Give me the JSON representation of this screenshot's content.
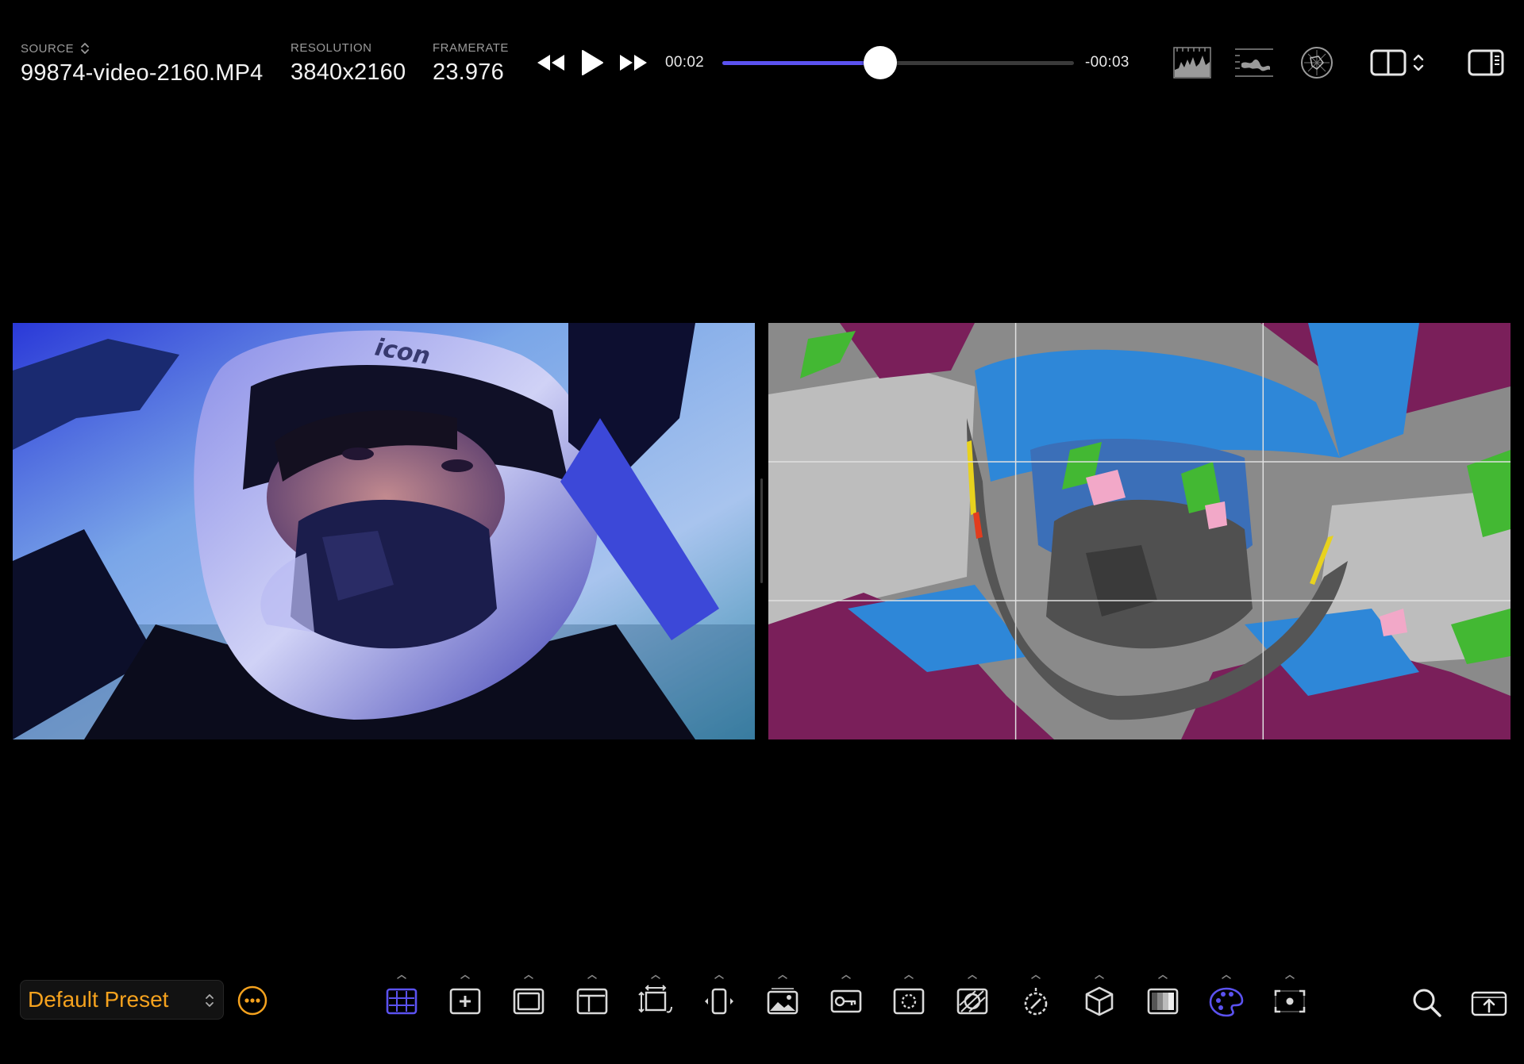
{
  "source": {
    "label": "SOURCE",
    "filename": "99874-video-2160.MP4"
  },
  "resolution": {
    "label": "RESOLUTION",
    "value": "3840x2160"
  },
  "framerate": {
    "label": "FRAMERATE",
    "value": "23.976"
  },
  "playback": {
    "current_time": "00:02",
    "remaining_time": "-00:03",
    "progress": 0.45
  },
  "colors": {
    "accent": "#5b52f0",
    "preset": "#f5a21e",
    "icon": "#d9d9d9"
  },
  "top_icons": [
    "histogram-icon",
    "waveform-icon",
    "vectorscope-icon",
    "split-view-icon",
    "sidebar-icon"
  ],
  "viewers": {
    "left": "original",
    "right": "false-color"
  },
  "preset": {
    "selected": "Default Preset"
  },
  "tools": [
    {
      "name": "grid-overlay-icon",
      "active": true
    },
    {
      "name": "crosshair-icon",
      "active": false
    },
    {
      "name": "safe-area-icon",
      "active": false
    },
    {
      "name": "frame-guide-icon",
      "active": false
    },
    {
      "name": "transform-icon",
      "active": false
    },
    {
      "name": "anamorphic-icon",
      "active": false
    },
    {
      "name": "image-overlay-icon",
      "active": false
    },
    {
      "name": "key-icon",
      "active": false
    },
    {
      "name": "focus-peaking-icon",
      "active": false
    },
    {
      "name": "zebra-icon",
      "active": false
    },
    {
      "name": "exposure-icon",
      "active": false
    },
    {
      "name": "lut-cube-icon",
      "active": false
    },
    {
      "name": "gradient-icon",
      "active": false
    },
    {
      "name": "false-color-icon",
      "active": true
    },
    {
      "name": "spot-meter-icon",
      "active": false
    }
  ]
}
